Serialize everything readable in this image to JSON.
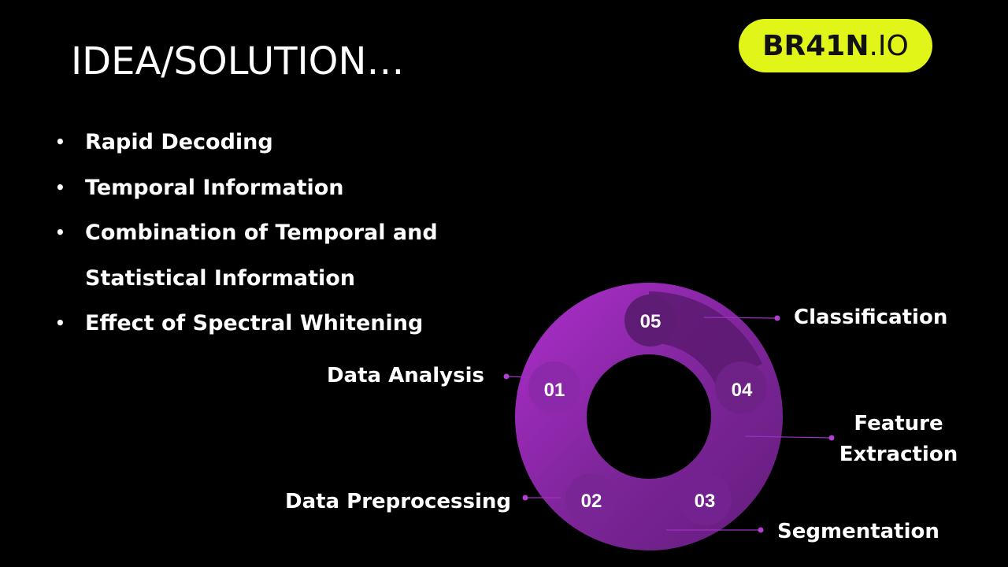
{
  "slide": {
    "title": "IDEA/SOLUTION…",
    "logo": {
      "main": "BR41N",
      "suffix": ".IO"
    },
    "bullets": [
      {
        "text": "Rapid Decoding"
      },
      {
        "text": "Temporal Information"
      },
      {
        "text": "Combination of Temporal and Statistical Information"
      },
      {
        "text": "Effect of Spectral Whitening"
      }
    ]
  },
  "cycle": {
    "stages": [
      {
        "number": "01",
        "label": "Data Analysis"
      },
      {
        "number": "02",
        "label": "Data Preprocessing"
      },
      {
        "number": "03",
        "label": "Segmentation"
      },
      {
        "number": "04",
        "label_lines": [
          "Feature",
          "Extraction"
        ]
      },
      {
        "number": "05",
        "label": "Classification"
      }
    ]
  },
  "colors": {
    "background": "#000000",
    "logo_bg": "#e1f518",
    "ring_light": "#9a2bb8",
    "ring_mid": "#7d2599",
    "ring_dark": "#5a1a6e",
    "connector": "#9b30c0"
  }
}
